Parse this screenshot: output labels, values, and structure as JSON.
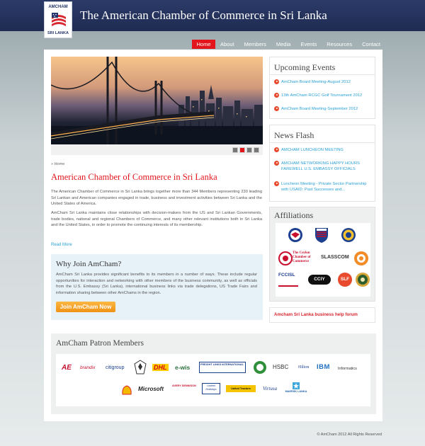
{
  "header": {
    "logo_top": "AMCHAM",
    "logo_bottom": "SRI LANKA",
    "site_title": "The American Chamber of Commerce in Sri Lanka"
  },
  "nav": {
    "items": [
      "Home",
      "About",
      "Members",
      "Media",
      "Events",
      "Resources",
      "Contact"
    ],
    "active": "Home"
  },
  "slider": {
    "dots": 4,
    "active_dot": 2
  },
  "main": {
    "breadcrumb": "» Home",
    "title": "American Chamber of Commerce in Sri Lanka",
    "paragraph1": "The American Chamber of Commerce in Sri Lanka brings together more than 344 Members representing 230 leading Sri Lankan and American companies engaged in trade, business and investment activities between Sri Lanka and the United States of America.",
    "paragraph2": "AmCham Sri Lanka maintains close relationships with decision-makers from the US and Sri Lankan Governments, trade bodies, national and regional Chambers of Commerce, and many other relevant institutions both in Sri Lanka and the United States, in order to promote the continuing interests of its membership.",
    "read_more": "Read More"
  },
  "why_join": {
    "title": "Why Join AmCham?",
    "text": "AmCham Sri Lanka provides significant benefits to its members in a number of ways. These include regular opportunities for interaction and networking with other members of the business community, as well as officials from the U.S. Embassy (Sri Lanka), international business links via trade delegations, US Trade Fairs and information sharing between other AmChams in the region.",
    "button": "Join AmCham Now"
  },
  "upcoming_events": {
    "title": "Upcoming Events",
    "items": [
      "AmCham Board Meeting-August 2012",
      "13th AmCham RCGC Golf Tournament 2012",
      "AmCham Board Meeting-September 2012"
    ]
  },
  "news_flash": {
    "title": "News Flash",
    "items": [
      "AMCHAM LUNCHEON MEETING",
      "AMCHAM NETWORKING HAPPY HOURS FAREWELL U.S. EMBASSY OFFICIALS",
      "Luncheon Meeting - Private Sector Partnership with USAID: Past Successes and..."
    ]
  },
  "affiliations": {
    "title": "Affiliations",
    "logos": {
      "ceylon_chamber": "The Ceylon Chamber of Commerce",
      "slasscom": "SLASSCOM",
      "fccisl": "FCCISL",
      "cciy": "CCIY",
      "slf": "SLF"
    }
  },
  "forum_link": "Amcham Sri Lanka business help forum",
  "patron": {
    "title": "AmCham Patron Members",
    "logos": [
      "AE",
      "brandix",
      "citigroup",
      "DHL",
      "e-wis",
      "FREIGHT LINKS INTERNATIONAL",
      "HSBC",
      "Hilton",
      "IBM",
      "Informatics",
      "Microsoft",
      "AVERY DENNISON",
      "United Holidays",
      "United Tractors",
      "Virtusa",
      "MAERSK LANKA"
    ]
  },
  "footer": "© AmCham 2012 All Rights Reserved",
  "colors": {
    "header_navy": "#23305e",
    "accent_red": "#e3141c",
    "link_blue": "#2aa0d6",
    "button_orange": "#f5a623"
  }
}
